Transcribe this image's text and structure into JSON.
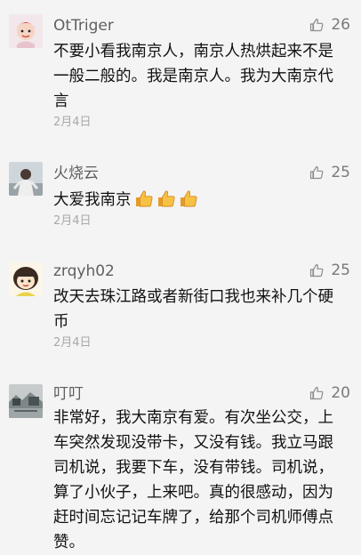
{
  "comments": [
    {
      "username": "OtTriger",
      "likes": "26",
      "text": "不要小看我南京人，南京人热烘起来不是一般二般的。我是南京人。我为大南京代言",
      "date": "2月4日",
      "avatar_icon": "avatar-girl-pink-icon"
    },
    {
      "username": "火烧云",
      "likes": "25",
      "text": "大爱我南京",
      "emoji": [
        "thumbs-up-icon",
        "thumbs-up-icon",
        "thumbs-up-icon"
      ],
      "date": "2月4日",
      "avatar_icon": "avatar-person-photo-icon"
    },
    {
      "username": "zrqyh02",
      "likes": "25",
      "text": "改天去珠江路或者新街口我也来补几个硬币",
      "date": "2月4日",
      "avatar_icon": "avatar-cartoon-girl-icon"
    },
    {
      "username": "叮叮",
      "likes": "20",
      "text": "非常好，我大南京有爱。有次坐公交，上车突然发现没带卡，又没有钱。我立马跟司机说，我要下车，没有带钱。司机说，算了小伙子，上来吧。真的很感动，因为赶时间忘记记车牌了，给那个司机师傅点赞。",
      "date": "",
      "avatar_icon": "avatar-landscape-icon"
    }
  ],
  "colors": {
    "background": "#f4f4f4",
    "username": "#5f5f5f",
    "date": "#a9a9a9",
    "like_icon": "#8b8b8b"
  }
}
